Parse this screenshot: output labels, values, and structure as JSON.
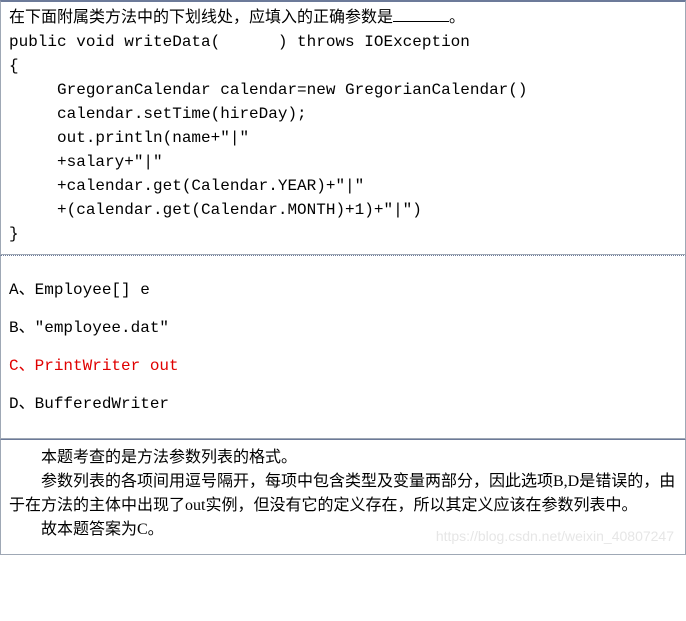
{
  "question": {
    "prompt_pre": "在下面附属类方法中的下划线处，应填入的正确参数是",
    "prompt_post": "。",
    "code": "public void writeData(      ) throws IOException\n{\n     GregoranCalendar calendar=new GregorianCalendar()\n     calendar.setTime(hireDay);\n     out.println(name+\"|\"\n     +salary+\"|\"\n     +calendar.get(Calendar.YEAR)+\"|\"\n     +(calendar.get(Calendar.MONTH)+1)+\"|\")\n}"
  },
  "options": [
    {
      "label": "A、",
      "text": "Employee[] e",
      "correct": false
    },
    {
      "label": "B、",
      "text": "\"employee.dat\"",
      "correct": false
    },
    {
      "label": "C、",
      "text": "PrintWriter out",
      "correct": true
    },
    {
      "label": "D、",
      "text": "BufferedWriter",
      "correct": false
    }
  ],
  "explanation": {
    "p1": "本题考查的是方法参数列表的格式。",
    "p2": "参数列表的各项间用逗号隔开，每项中包含类型及变量两部分，因此选项B,D是错误的，由于在方法的主体中出现了out实例，但没有它的定义存在，所以其定义应该在参数列表中。",
    "p3": "故本题答案为C。"
  },
  "watermark": "https://blog.csdn.net/weixin_40807247"
}
